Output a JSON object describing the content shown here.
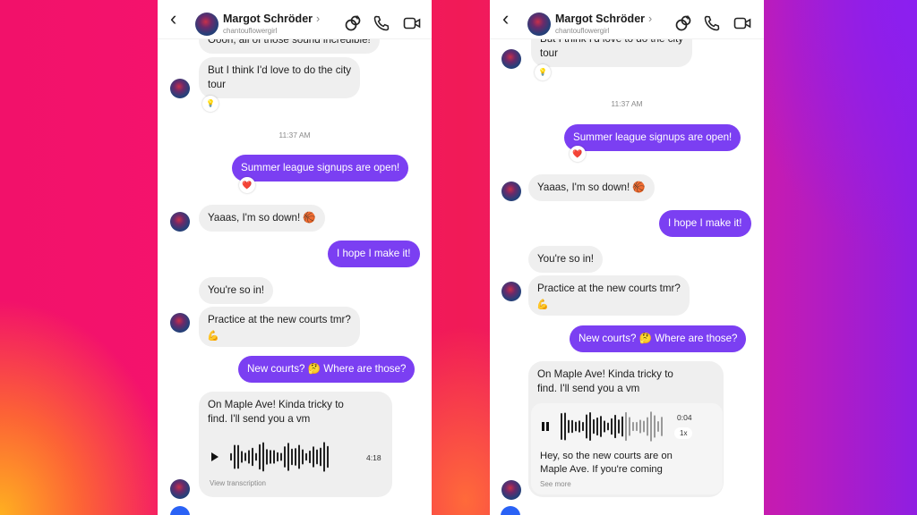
{
  "left": {
    "header": {
      "name": "Margot Schröder",
      "chevron": "›",
      "username": "chantouflowergirl",
      "back": "‹"
    },
    "msg_top": "Oooh, all of those sound incredible!",
    "msg_city": "But I think I'd love to do the city\ntour",
    "time": "11:37 AM",
    "msg_league": "Summer league signups are open!",
    "react_heart": "❤️",
    "msg_down": "Yaaas, I'm so down! 🏀",
    "msg_hope": "I hope I make it!",
    "msg_in": "You're so in!",
    "msg_practice": "Practice at the new courts tmr?",
    "react_muscle": "💪",
    "msg_where": "New courts? 🤔 Where are those?",
    "msg_maple": "On Maple Ave! Kinda tricky to\nfind. I'll send you a vm",
    "voice": {
      "duration": "4:18",
      "link": "View transcription"
    }
  },
  "right": {
    "header": {
      "name": "Margot Schröder",
      "chevron": "›",
      "username": "chantouflowergirl",
      "back": "‹"
    },
    "msg_city": "But I think I'd love to do the city\ntour",
    "time": "11:37 AM",
    "msg_league": "Summer league signups are open!",
    "react_heart": "❤️",
    "msg_down": "Yaaas, I'm so down! 🏀",
    "msg_hope": "I hope I make it!",
    "msg_in": "You're so in!",
    "msg_practice": "Practice at the new courts tmr?",
    "react_muscle": "💪",
    "msg_where": "New courts? 🤔 Where are those?",
    "msg_maple": "On Maple Ave! Kinda tricky to\nfind. I'll send you a vm",
    "voice": {
      "duration": "0:04",
      "speed": "1x",
      "transcript": "Hey, so the new courts are on\nMaple Ave. If you're coming",
      "link": "See more"
    }
  }
}
